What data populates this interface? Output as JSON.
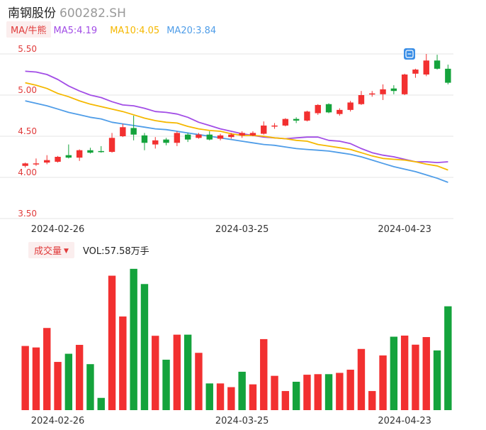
{
  "header": {
    "name": "南钢股份",
    "code": "600282.SH"
  },
  "ma_legend": {
    "tag": "MA/牛熊",
    "items": [
      {
        "label": "MA5:4.19",
        "color": "#a24de6"
      },
      {
        "label": "MA10:4.05",
        "color": "#f5b800"
      },
      {
        "label": "MA20:3.84",
        "color": "#4f9de8"
      }
    ]
  },
  "volume_legend": {
    "tag": "成交量",
    "value": "VOL:57.58万手"
  },
  "colors": {
    "up": "#f23030",
    "down": "#14a33c",
    "axis_up": "#e03a3a",
    "axis_down": "#14a33c"
  },
  "chart_data": [
    {
      "type": "candlestick",
      "ylim": [
        3.5,
        5.5
      ],
      "yticks": [
        "5.50",
        "5.00",
        "4.50",
        "4.00",
        "3.50"
      ],
      "xtick_labels": [
        {
          "index": 3,
          "label": "2024-02-26"
        },
        {
          "index": 20,
          "label": "2024-03-25"
        },
        {
          "index": 35,
          "label": "2024-04-23"
        }
      ],
      "candles": [
        {
          "o": 4.14,
          "c": 4.17,
          "h": 4.18,
          "l": 4.12
        },
        {
          "o": 4.16,
          "c": 4.17,
          "h": 4.23,
          "l": 4.14
        },
        {
          "o": 4.18,
          "c": 4.21,
          "h": 4.27,
          "l": 4.16
        },
        {
          "o": 4.19,
          "c": 4.25,
          "h": 4.26,
          "l": 4.18
        },
        {
          "o": 4.27,
          "c": 4.24,
          "h": 4.4,
          "l": 4.23
        },
        {
          "o": 4.24,
          "c": 4.33,
          "h": 4.34,
          "l": 4.2
        },
        {
          "o": 4.33,
          "c": 4.3,
          "h": 4.36,
          "l": 4.29
        },
        {
          "o": 4.32,
          "c": 4.31,
          "h": 4.38,
          "l": 4.3
        },
        {
          "o": 4.31,
          "c": 4.48,
          "h": 4.54,
          "l": 4.3
        },
        {
          "o": 4.5,
          "c": 4.61,
          "h": 4.65,
          "l": 4.49
        },
        {
          "o": 4.6,
          "c": 4.52,
          "h": 4.75,
          "l": 4.45
        },
        {
          "o": 4.51,
          "c": 4.42,
          "h": 4.54,
          "l": 4.33
        },
        {
          "o": 4.4,
          "c": 4.45,
          "h": 4.49,
          "l": 4.35
        },
        {
          "o": 4.46,
          "c": 4.42,
          "h": 4.48,
          "l": 4.39
        },
        {
          "o": 4.42,
          "c": 4.54,
          "h": 4.56,
          "l": 4.38
        },
        {
          "o": 4.52,
          "c": 4.46,
          "h": 4.54,
          "l": 4.43
        },
        {
          "o": 4.48,
          "c": 4.52,
          "h": 4.54,
          "l": 4.47
        },
        {
          "o": 4.52,
          "c": 4.46,
          "h": 4.56,
          "l": 4.45
        },
        {
          "o": 4.47,
          "c": 4.51,
          "h": 4.53,
          "l": 4.45
        },
        {
          "o": 4.49,
          "c": 4.52,
          "h": 4.54,
          "l": 4.47
        },
        {
          "o": 4.51,
          "c": 4.54,
          "h": 4.56,
          "l": 4.48
        },
        {
          "o": 4.51,
          "c": 4.54,
          "h": 4.56,
          "l": 4.5
        },
        {
          "o": 4.53,
          "c": 4.63,
          "h": 4.68,
          "l": 4.52
        },
        {
          "o": 4.62,
          "c": 4.63,
          "h": 4.66,
          "l": 4.59
        },
        {
          "o": 4.63,
          "c": 4.71,
          "h": 4.72,
          "l": 4.62
        },
        {
          "o": 4.71,
          "c": 4.69,
          "h": 4.73,
          "l": 4.66
        },
        {
          "o": 4.69,
          "c": 4.8,
          "h": 4.81,
          "l": 4.68
        },
        {
          "o": 4.78,
          "c": 4.88,
          "h": 4.89,
          "l": 4.76
        },
        {
          "o": 4.89,
          "c": 4.79,
          "h": 4.9,
          "l": 4.78
        },
        {
          "o": 4.77,
          "c": 4.82,
          "h": 4.84,
          "l": 4.75
        },
        {
          "o": 4.82,
          "c": 4.91,
          "h": 4.93,
          "l": 4.8
        },
        {
          "o": 4.89,
          "c": 5.0,
          "h": 5.05,
          "l": 4.88
        },
        {
          "o": 5.01,
          "c": 5.02,
          "h": 5.05,
          "l": 4.98
        },
        {
          "o": 5.01,
          "c": 5.07,
          "h": 5.13,
          "l": 4.94
        },
        {
          "o": 5.08,
          "c": 5.05,
          "h": 5.12,
          "l": 5.01
        },
        {
          "o": 5.01,
          "c": 5.25,
          "h": 5.26,
          "l": 5.0
        },
        {
          "o": 5.26,
          "c": 5.31,
          "h": 5.32,
          "l": 5.21
        },
        {
          "o": 5.25,
          "c": 5.42,
          "h": 5.5,
          "l": 5.23
        },
        {
          "o": 5.42,
          "c": 5.32,
          "h": 5.49,
          "l": 5.31
        },
        {
          "o": 5.32,
          "c": 5.15,
          "h": 5.37,
          "l": 5.13
        }
      ],
      "ma": [
        {
          "name": "MA5",
          "color": "#a24de6",
          "values": [
            5.29,
            5.28,
            5.25,
            5.19,
            5.11,
            5.05,
            5.0,
            4.97,
            4.92,
            4.88,
            4.87,
            4.84,
            4.8,
            4.79,
            4.77,
            4.73,
            4.67,
            4.63,
            4.59,
            4.56,
            4.53,
            4.51,
            4.49,
            4.48,
            4.47,
            4.48,
            4.49,
            4.49,
            4.45,
            4.44,
            4.41,
            4.35,
            4.3,
            4.27,
            4.25,
            4.22,
            4.19,
            4.19,
            4.18,
            4.19
          ]
        },
        {
          "name": "MA10",
          "color": "#f5b800",
          "values": [
            5.15,
            5.12,
            5.08,
            5.02,
            4.98,
            4.93,
            4.89,
            4.86,
            4.83,
            4.8,
            4.76,
            4.72,
            4.69,
            4.67,
            4.66,
            4.62,
            4.59,
            4.57,
            4.56,
            4.53,
            4.51,
            4.51,
            4.5,
            4.48,
            4.47,
            4.45,
            4.44,
            4.4,
            4.38,
            4.36,
            4.34,
            4.3,
            4.26,
            4.23,
            4.22,
            4.21,
            4.19,
            4.16,
            4.14,
            4.09
          ]
        },
        {
          "name": "MA20",
          "color": "#4f9de8",
          "values": [
            4.93,
            4.9,
            4.87,
            4.83,
            4.79,
            4.76,
            4.73,
            4.71,
            4.67,
            4.65,
            4.63,
            4.61,
            4.59,
            4.58,
            4.56,
            4.54,
            4.52,
            4.5,
            4.48,
            4.46,
            4.44,
            4.42,
            4.4,
            4.39,
            4.37,
            4.35,
            4.34,
            4.33,
            4.32,
            4.3,
            4.28,
            4.25,
            4.21,
            4.17,
            4.13,
            4.1,
            4.07,
            4.03,
            3.99,
            3.94
          ]
        }
      ]
    },
    {
      "type": "bar",
      "title": "成交量",
      "unit": "万手",
      "ylim": [
        0,
        75
      ],
      "series": [
        {
          "name": "VOL",
          "values": [
            34.6,
            33.8,
            44.3,
            26.0,
            30.4,
            35.2,
            24.8,
            6.6,
            72.5,
            50.5,
            76.2,
            68.0,
            40.1,
            27.2,
            40.7,
            40.7,
            30.9,
            14.4,
            14.4,
            12.4,
            20.7,
            13.9,
            38.3,
            18.5,
            10.3,
            15.3,
            19.1,
            19.4,
            19.4,
            20.1,
            21.8,
            33.0,
            10.3,
            29.5,
            39.6,
            40.2,
            35.3,
            39.4,
            32.2,
            56.0
          ],
          "up": [
            true,
            true,
            true,
            true,
            false,
            true,
            false,
            false,
            true,
            true,
            false,
            false,
            true,
            false,
            true,
            false,
            true,
            false,
            true,
            true,
            false,
            true,
            true,
            true,
            true,
            false,
            true,
            true,
            false,
            true,
            true,
            true,
            true,
            true,
            false,
            true,
            true,
            true,
            false,
            false
          ]
        }
      ],
      "xtick_labels": [
        {
          "index": 3,
          "label": "2024-02-26"
        },
        {
          "index": 20,
          "label": "2024-03-25"
        },
        {
          "index": 35,
          "label": "2024-04-23"
        }
      ]
    }
  ]
}
